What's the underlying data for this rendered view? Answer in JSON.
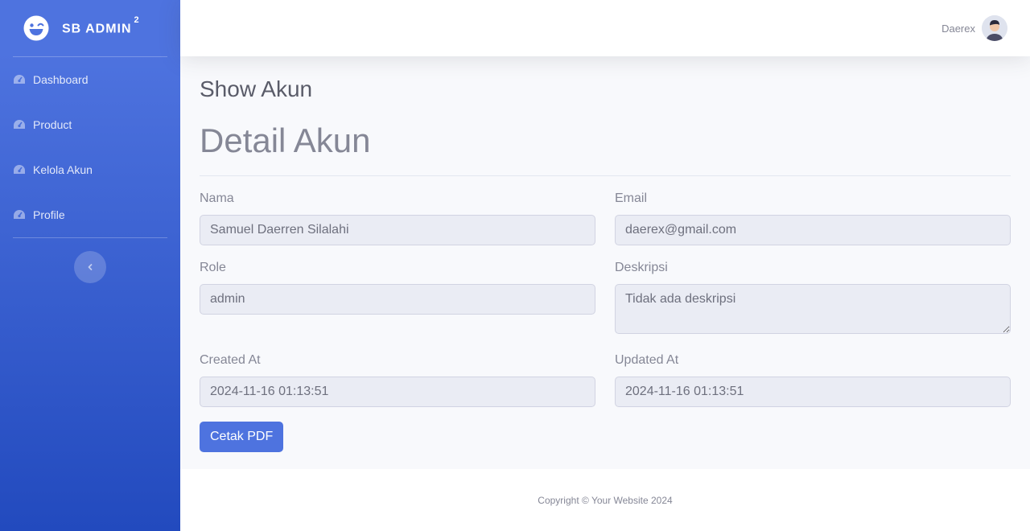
{
  "brand": {
    "name": "SB Admin",
    "superscript": "2",
    "icon": "laugh-wink-icon"
  },
  "sidebar": {
    "items": [
      {
        "label": "Dashboard",
        "icon": "tachometer-icon"
      },
      {
        "label": "Product",
        "icon": "tachometer-icon"
      },
      {
        "label": "Kelola Akun",
        "icon": "tachometer-icon"
      },
      {
        "label": "Profile",
        "icon": "tachometer-icon"
      }
    ],
    "toggle_icon": "chevron-left-icon"
  },
  "topbar": {
    "user_name": "Daerex",
    "avatar_icon": "user-avatar-icon"
  },
  "page": {
    "title": "Show Akun",
    "heading": "Detail Akun"
  },
  "form": {
    "nama": {
      "label": "Nama",
      "value": "Samuel Daerren Silalahi"
    },
    "email": {
      "label": "Email",
      "value": "daerex@gmail.com"
    },
    "role": {
      "label": "Role",
      "value": "admin"
    },
    "deskripsi": {
      "label": "Deskripsi",
      "value": "Tidak ada deskripsi"
    },
    "created_at": {
      "label": "Created At",
      "value": "2024-11-16 01:13:51"
    },
    "updated_at": {
      "label": "Updated At",
      "value": "2024-11-16 01:13:51"
    },
    "print_button": "Cetak PDF"
  },
  "footer": {
    "copyright": "Copyright © Your Website 2024"
  },
  "colors": {
    "primary": "#4e73df",
    "primary_dark": "#224abe",
    "text_muted": "#858796",
    "text_dark": "#5a5c69",
    "input_bg": "#eaecf4"
  }
}
